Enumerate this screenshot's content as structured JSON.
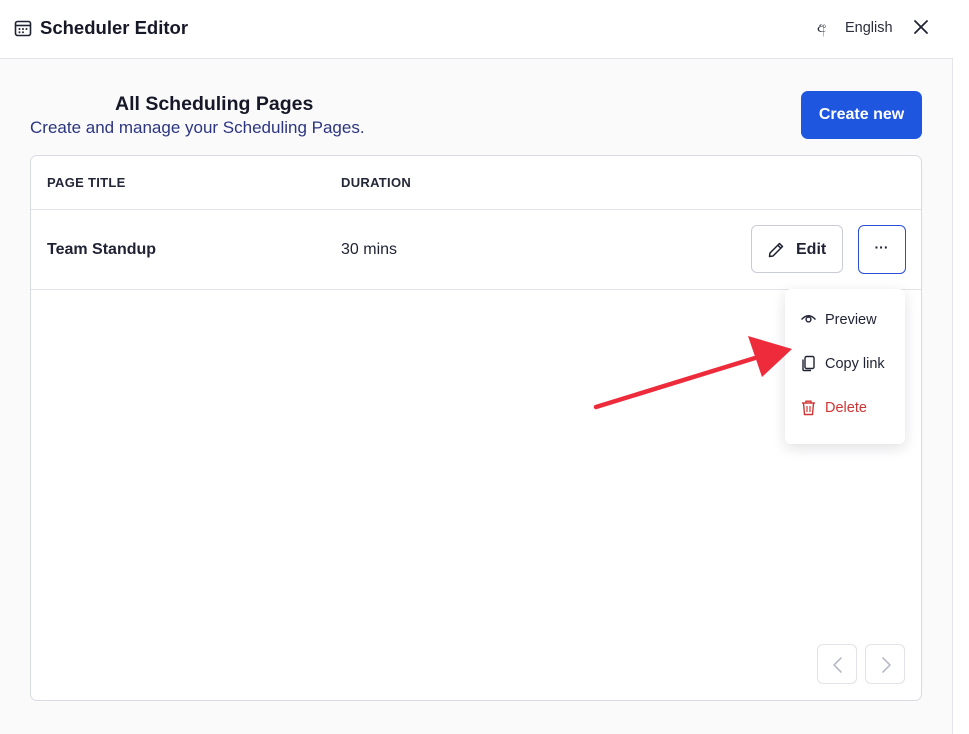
{
  "header": {
    "title": "Scheduler Editor",
    "language": "English",
    "icons": {
      "calendar": "calendar-icon",
      "language": "language-icon",
      "close": "close-icon"
    }
  },
  "main": {
    "heading": "All Scheduling Pages",
    "subheading": "Create and manage your Scheduling Pages.",
    "create_button": "Create new"
  },
  "table": {
    "columns": [
      "PAGE TITLE",
      "DURATION"
    ],
    "rows": [
      {
        "title": "Team Standup",
        "duration": "30 mins"
      }
    ],
    "row_actions": {
      "edit_label": "Edit",
      "more_label": "···"
    }
  },
  "menu": {
    "items": [
      {
        "label": "Preview",
        "icon": "eye-icon"
      },
      {
        "label": "Copy link",
        "icon": "copy-icon"
      },
      {
        "label": "Delete",
        "icon": "trash-icon"
      }
    ]
  },
  "colors": {
    "accent": "#1f56e0",
    "danger": "#cf3434",
    "annotation_arrow": "#ee2b3b"
  }
}
